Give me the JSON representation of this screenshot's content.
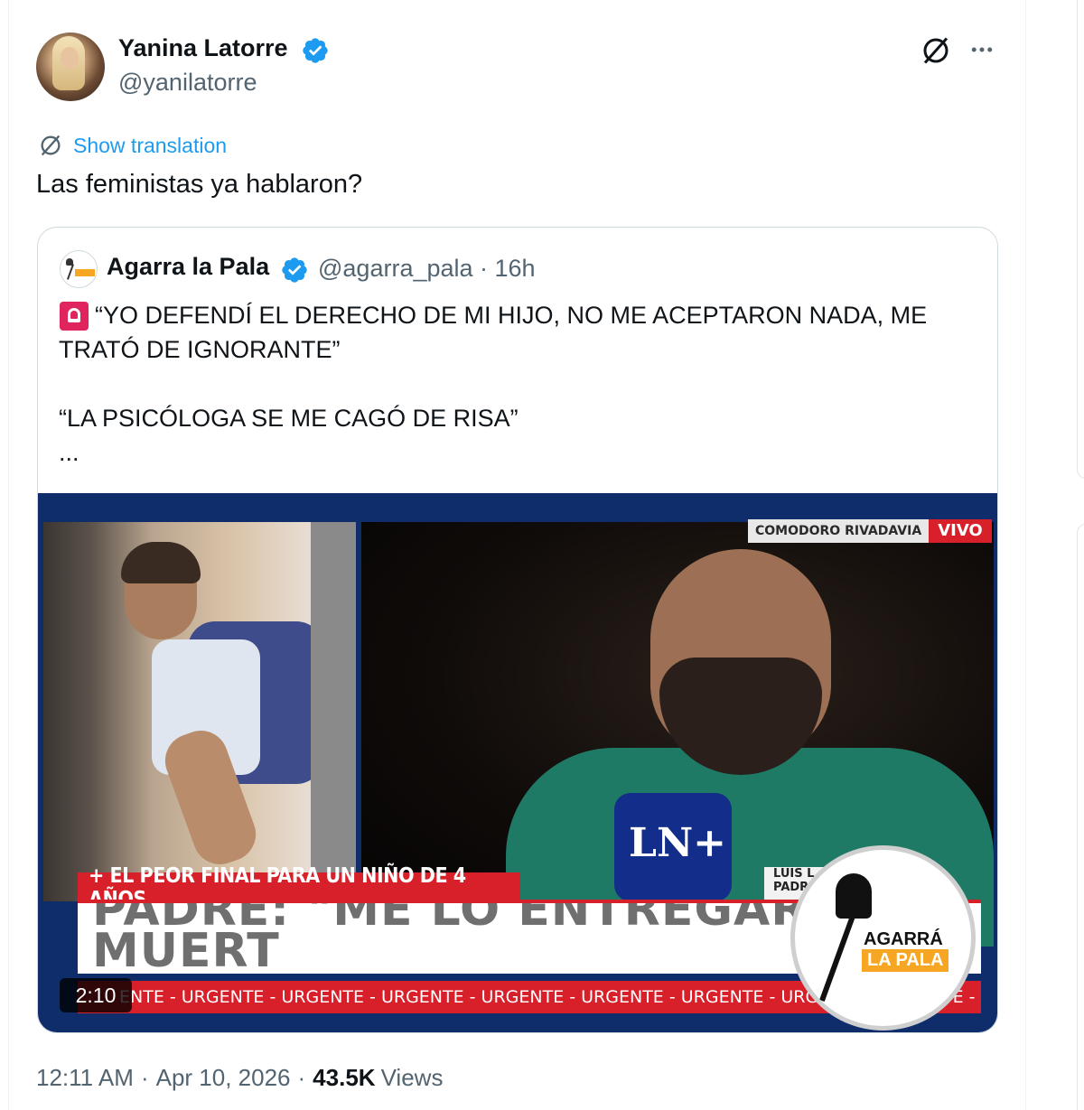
{
  "tweet": {
    "author": {
      "display_name": "Yanina Latorre",
      "handle": "@yanilatorre"
    },
    "show_translation": "Show translation",
    "text": "Las feministas ya hablaron?",
    "time": "12:11 AM",
    "date": "Apr 10, 2026",
    "views_count": "43.5K",
    "views_label": "Views",
    "separator": "·"
  },
  "quote": {
    "author": {
      "display_name": "Agarra la Pala",
      "handle": "@agarra_pala · 16h"
    },
    "lines": {
      "l1": "“YO DEFENDÍ EL DERECHO DE MI HIJO, NO ME ACEPTARON NADA, ME",
      "l2": "TRATÓ DE IGNORANTE”",
      "l3": "“LA PSICÓLOGA SE ME CAGÓ DE RISA”",
      "l4": "..."
    },
    "video": {
      "duration": "2:10",
      "location": "COMODORO RIVADAVIA",
      "live": "VIVO",
      "lower_third": "+ EL PEOR FINAL PARA UN NIÑO DE 4 AÑOS",
      "headline": "PADRE: \"ME LO ENTREGARON MUERT",
      "name_line1": "LUIS L",
      "name_line2": "PADR",
      "mic_logo": "LN+",
      "ticker": "ENTE - URGENTE - URGENTE - URGENTE - URGENTE - URGENTE - URGENTE - URGENTE - URGENTE -",
      "logo_word1": "AGARRÁ",
      "logo_word2": "LA PALA"
    }
  },
  "colors": {
    "accent": "#1d9bf0",
    "muted": "#536471",
    "text": "#0f1419",
    "border": "#cfd9de",
    "news_red": "#d8202a",
    "news_blue": "#0f2d6b"
  },
  "icons": [
    "verified-badge-icon",
    "grok-icon",
    "more-icon",
    "translate-icon",
    "siren-emoji-icon"
  ]
}
